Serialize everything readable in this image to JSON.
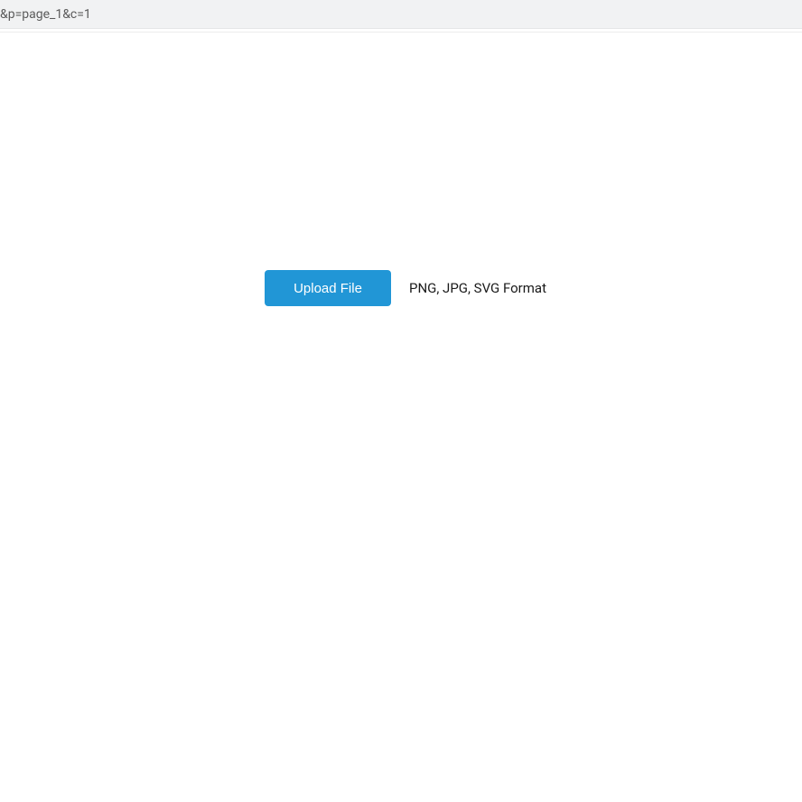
{
  "url_bar": {
    "fragment": "&p=page_1&c=1"
  },
  "upload": {
    "button_label": "Upload File",
    "format_hint": "PNG, JPG, SVG Format"
  }
}
